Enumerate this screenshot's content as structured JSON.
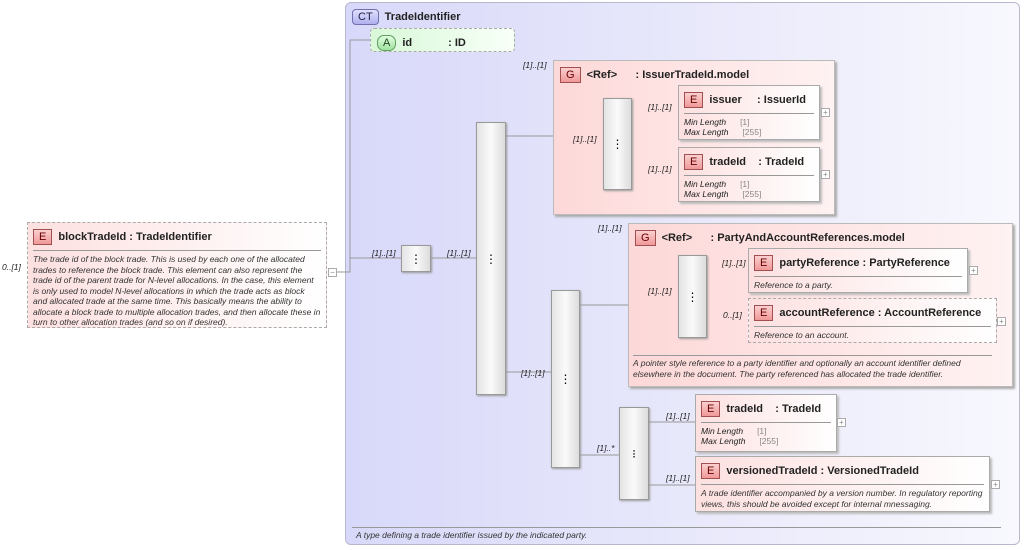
{
  "complex_type": {
    "badge": "CT",
    "name": "TradeIdentifier",
    "description": "A type defining a trade identifier issued by the indicated party."
  },
  "attribute": {
    "badge": "A",
    "name": "id",
    "type": ": ID"
  },
  "root": {
    "badge": "E",
    "name": "blockTradeId",
    "type": " : TradeIdentifier",
    "cardinality": "0..[1]",
    "description": "The trade id of the block trade. This is used by each one of the allocated trades to reference the block trade. This element can also represent the trade id of the parent trade for N-level allocations. In the case, this element is only used to model N-level allocations in which the trade acts as block and allocated trade at the same time. This basically means the ability to allocate a block trade to multiple allocation trades, and then allocate these in turn to other allocation trades (and so on if desired)."
  },
  "connectors": {
    "seq1": "[1]..[1]",
    "seq2": "[1]..[1]",
    "group1": "[1]..[1]",
    "group1_inner": "[1]..[1]",
    "seq3": "[1]..[1]",
    "group2": "[1]..[1]",
    "group2_inner": "[1]..[1]",
    "choice": "[1]..*"
  },
  "group1": {
    "badge": "G",
    "ref": "<Ref>",
    "name": "      : IssuerTradeId.model",
    "elements": [
      {
        "badge": "E",
        "name": "issuer",
        "type": "     : IssuerId",
        "cardinality": "[1]..[1]",
        "facets": [
          {
            "label": "Min Length",
            "value": "[1]"
          },
          {
            "label": "Max Length",
            "value": "[255]"
          }
        ]
      },
      {
        "badge": "E",
        "name": "tradeId",
        "type": "    : TradeId",
        "cardinality": "[1]..[1]",
        "facets": [
          {
            "label": "Min Length",
            "value": "[1]"
          },
          {
            "label": "Max Length",
            "value": "[255]"
          }
        ]
      }
    ]
  },
  "group2": {
    "badge": "G",
    "ref": "<Ref>",
    "name": "      : PartyAndAccountReferences.model",
    "description": "A pointer style reference to a party identifier and optionally an account identifier defined elsewhere in the document. The party referenced has allocated the trade identifier.",
    "elements": [
      {
        "badge": "E",
        "name": "partyReference",
        "type": " : PartyReference",
        "cardinality": "[1]..[1]",
        "description": "Reference to a party."
      },
      {
        "badge": "E",
        "name": "accountReference",
        "type": " : AccountReference",
        "cardinality": "0..[1]",
        "description": "Reference to an account."
      }
    ]
  },
  "choice": {
    "elements": [
      {
        "badge": "E",
        "name": "tradeId",
        "type": "    : TradeId",
        "cardinality": "[1]..[1]",
        "facets": [
          {
            "label": "Min Length",
            "value": "[1]"
          },
          {
            "label": "Max Length",
            "value": "[255]"
          }
        ]
      },
      {
        "badge": "E",
        "name": "versionedTradeId",
        "type": " : VersionedTradeId",
        "cardinality": "[1]..[1]",
        "description": "A trade identifier accompanied by a version number. In regulatory reporting views, this should be avoided except for internal mnessaging."
      }
    ]
  },
  "expand_symbol": "+",
  "collapse_symbol": "−"
}
